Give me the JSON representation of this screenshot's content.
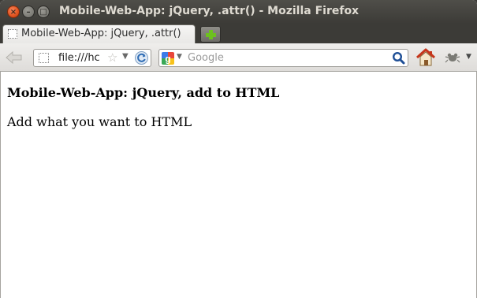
{
  "window": {
    "title": "Mobile-Web-App: jQuery, .attr() - Mozilla Firefox",
    "controls": {
      "close": "×",
      "minimize": "–",
      "maximize": "□"
    }
  },
  "tabs": [
    {
      "label": "Mobile-Web-App: jQuery, .attr()",
      "active": true
    }
  ],
  "navbar": {
    "url": "file:///hc",
    "search_placeholder": "Google",
    "icons": [
      "back-arrow-icon",
      "page-icon",
      "bookmark-star-icon",
      "dropdown-arrow-icon",
      "reload-icon",
      "google-icon",
      "search-magnifier-icon",
      "home-icon",
      "addon-icon"
    ]
  },
  "page": {
    "heading": "Mobile-Web-App: jQuery, add to HTML",
    "paragraph": "Add what you want to HTML"
  },
  "colors": {
    "titlebar": "#3c3b37",
    "close_button": "#e0531f",
    "new_tab_plus": "#6dc01f",
    "content_bg": "#ffffff"
  }
}
